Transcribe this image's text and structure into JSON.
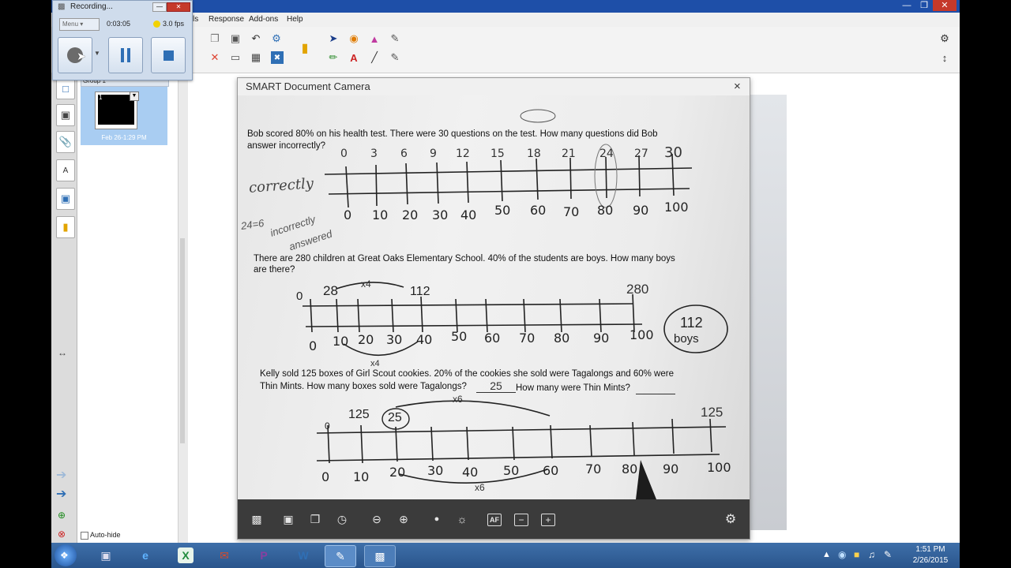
{
  "recording": {
    "title": "Recording...",
    "menu_label": "Menu",
    "elapsed": "0:03:05",
    "fps": "3.0 fps"
  },
  "menu": {
    "items": [
      "ls",
      "Response",
      "Add-ons",
      "Help"
    ]
  },
  "sorter": {
    "group_label": "Group 1",
    "page_number": "1",
    "page_timestamp": "Feb 26-1:29 PM",
    "autohide_label": "Auto-hide"
  },
  "camera": {
    "title": "SMART Document Camera",
    "close_glyph": "×"
  },
  "worksheet": {
    "q1_line1": "Bob scored 80% on his health test.  There were 30 questions on the test.  How many questions did Bob",
    "q1_line2": "answer incorrectly?",
    "q1_top": [
      "0",
      "3",
      "6",
      "9",
      "12",
      "15",
      "18",
      "21",
      "24",
      "27",
      "30"
    ],
    "q1_bottom": [
      "0",
      "10",
      "20",
      "30",
      "40",
      "50",
      "60",
      "70",
      "80",
      "90",
      "100"
    ],
    "q1_note_left": "correctly",
    "q1_note_eq": "24=6",
    "q1_note_incorrect": "incorrectly",
    "q1_note_answered": "answered",
    "q2_line1": "There are 280 children at Great Oaks Elementary School.  40% of the students are boys.  How many boys",
    "q2_line2": "are there?",
    "q2_bottom": [
      "0",
      "10",
      "20",
      "30",
      "40",
      "50",
      "60",
      "70",
      "80",
      "90",
      "100"
    ],
    "q2_top_0": "0",
    "q2_top_28": "28",
    "q2_top_112": "112",
    "q2_top_280": "280",
    "q2_times": "x4",
    "q2_answer1": "112",
    "q2_answer2": "boys",
    "q3_line1": "Kelly sold 125 boxes of Girl Scout cookies.  20% of the cookies she sold were Tagalongs and 60% were",
    "q3_line2": "Thin Mints.  How many boxes sold were Tagalongs?",
    "q3_blank_answer": "25",
    "q3_line2b": "How many were Thin Mints?",
    "q3_bottom": [
      "0",
      "10",
      "20",
      "30",
      "40",
      "50",
      "60",
      "70",
      "80",
      "90",
      "100"
    ],
    "q3_top_0": "0",
    "q3_top_125a": "125",
    "q3_top_25": "25",
    "q3_top_125b": "125",
    "q3_times": "x6"
  },
  "clock": {
    "time": "1:51 PM",
    "date": "2/26/2015"
  },
  "colors": {
    "titlebar": "#1e4fa8",
    "taskbar": "#2a558c",
    "sorter_selected": "#a9cdf2"
  }
}
